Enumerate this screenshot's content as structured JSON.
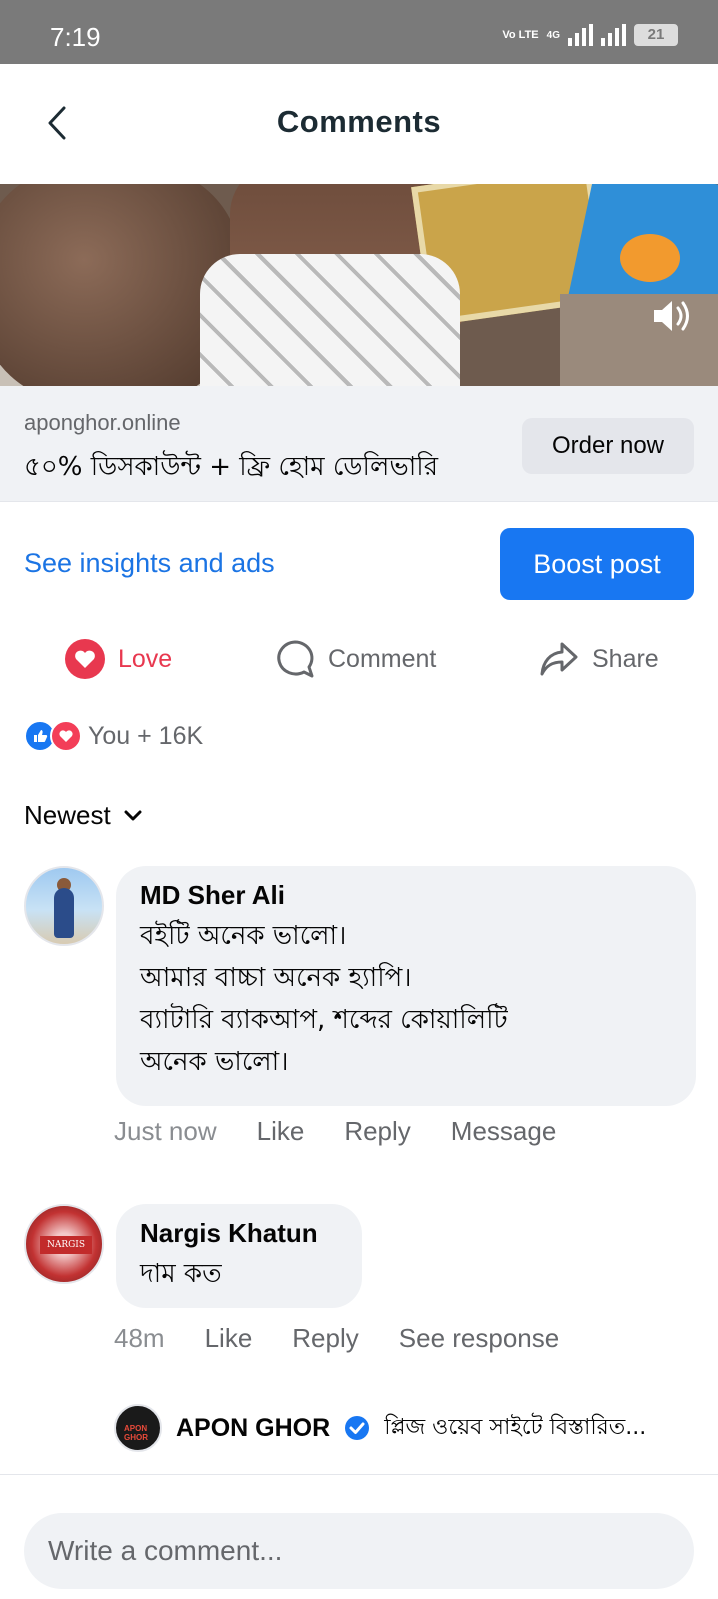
{
  "status_bar": {
    "time": "7:19",
    "network": "Vo LTE",
    "net_type": "4G",
    "battery": "21"
  },
  "header": {
    "title": "Comments"
  },
  "ad": {
    "domain": "aponghor.online",
    "text": "৫০% ডিসকাউন্ট + ফ্রি হোম ডেলিভারি",
    "cta": "Order now"
  },
  "insights": {
    "link": "See insights and ads",
    "boost": "Boost post"
  },
  "actions": {
    "love": "Love",
    "comment": "Comment",
    "share": "Share"
  },
  "reactions": {
    "summary": "You + 16K"
  },
  "sort": {
    "label": "Newest"
  },
  "comments": [
    {
      "name": "MD Sher Ali",
      "text": "বইটি অনেক ভালো।\nআমার বাচ্চা অনেক হ্যাপি।\nব্যাটারি ব্যাকআপ, শব্দের কোয়ালিটি\nঅনেক ভালো।",
      "time": "Just now",
      "like": "Like",
      "reply": "Reply",
      "extra": "Message"
    },
    {
      "name": "Nargis Khatun",
      "avatar_label": "NARGIS",
      "text": "দাম কত",
      "time": "48m",
      "like": "Like",
      "reply": "Reply",
      "extra": "See response"
    }
  ],
  "reply_preview": {
    "avatar_label": "APON GHOR",
    "name": "APON GHOR",
    "text": "প্লিজ ওয়েব সাইটে বিস্তারিত..."
  },
  "composer": {
    "placeholder": "Write a comment..."
  },
  "colors": {
    "primary": "#1877f2",
    "love": "#e8384f",
    "bubble": "#f0f2f5",
    "muted": "#65676b"
  }
}
